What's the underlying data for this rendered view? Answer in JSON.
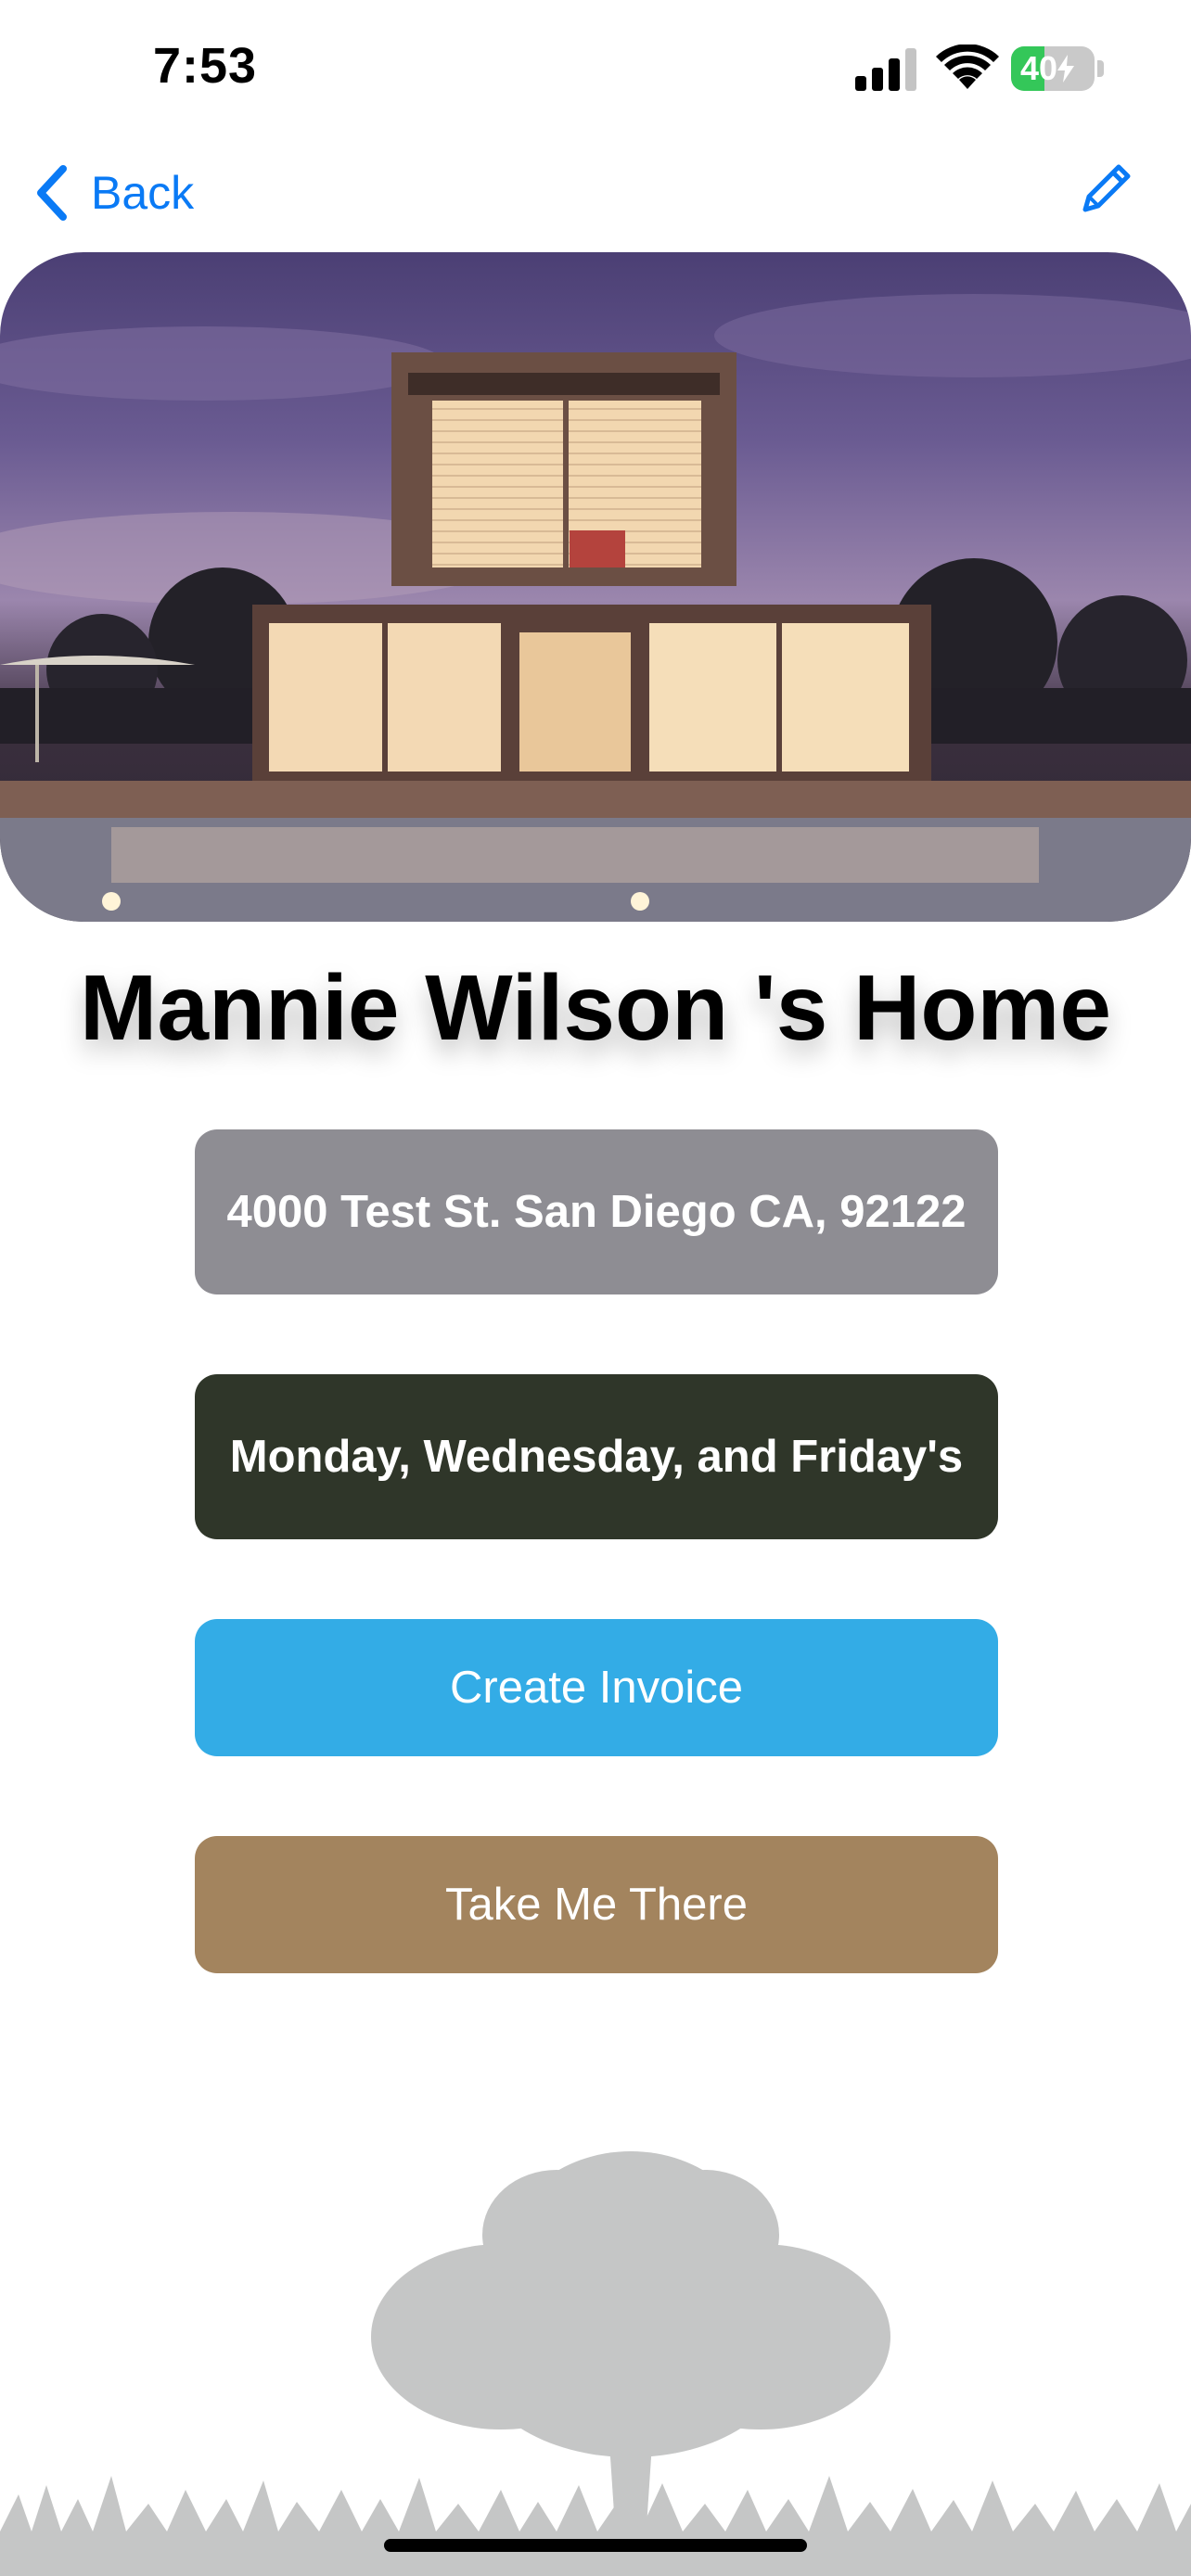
{
  "status_bar": {
    "time": "7:53",
    "battery_level": "40",
    "battery_fraction": 0.4,
    "icons": [
      "signal-icon",
      "wifi-icon",
      "battery-charging-icon"
    ]
  },
  "nav": {
    "back_label": "Back",
    "back_icon": "chevron-left-icon",
    "edit_icon": "pencil-icon",
    "accent_color": "#0a7af5"
  },
  "property": {
    "title": "Mannie Wilson 's Home",
    "address": "4000 Test St. San Diego CA, 92122",
    "schedule": "Monday, Wednesday, and Friday's"
  },
  "actions": {
    "create_invoice": "Create Invoice",
    "take_me_there": "Take Me There"
  },
  "colors": {
    "address_bg": "#8e8d93",
    "schedule_bg": "#2f3629",
    "invoice_bg": "#33ace6",
    "directions_bg": "#a3845e",
    "battery_green": "#34c759"
  }
}
